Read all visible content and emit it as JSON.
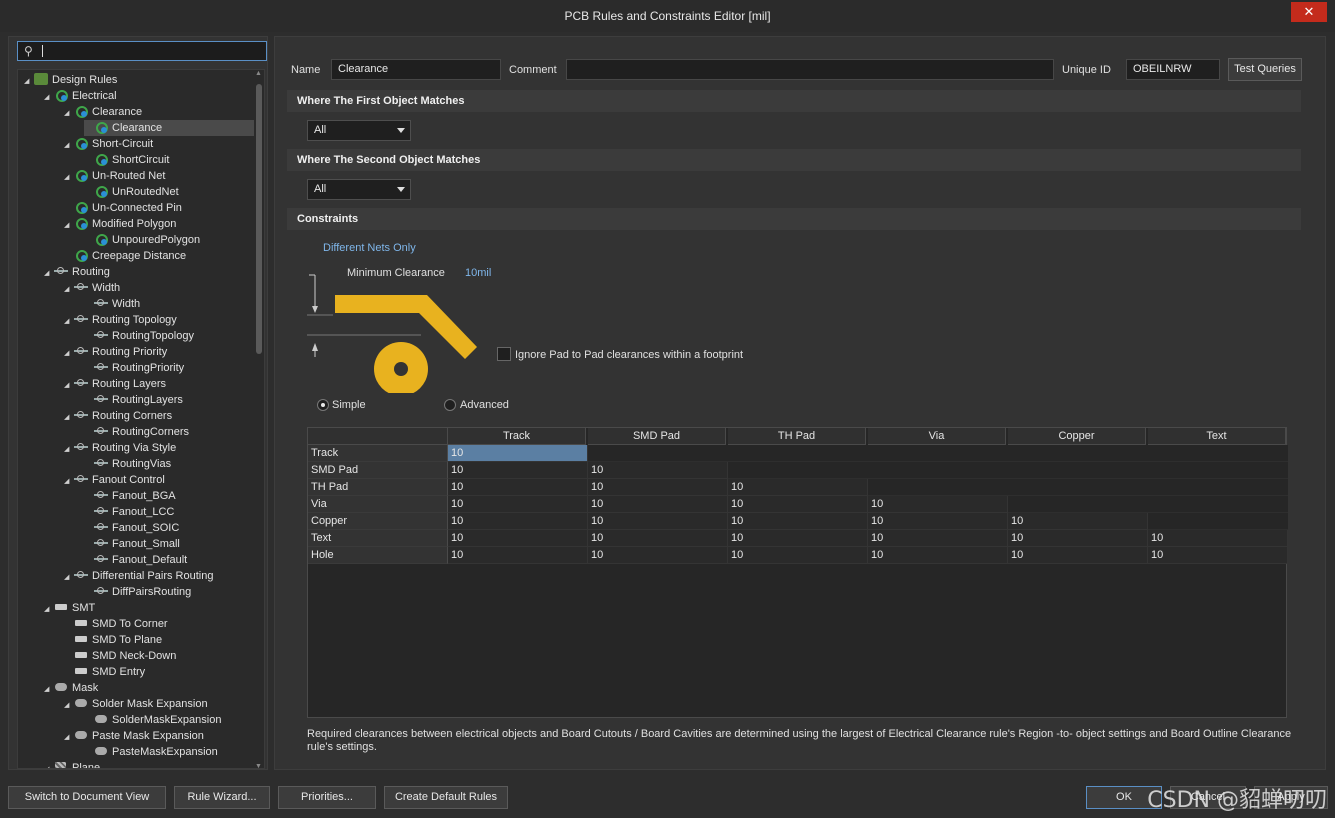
{
  "window": {
    "title": "PCB Rules and Constraints Editor [mil]",
    "close_glyph": "✕"
  },
  "search": {
    "icon": "search-icon",
    "value": ""
  },
  "tree": [
    {
      "label": "Design Rules",
      "icon": "cat",
      "depth": 0,
      "tw": "◢"
    },
    {
      "label": "Electrical",
      "icon": "elec",
      "depth": 1,
      "tw": "◢"
    },
    {
      "label": "Clearance",
      "icon": "elec",
      "depth": 2,
      "tw": "◢"
    },
    {
      "label": "Clearance",
      "icon": "elec",
      "depth": 3,
      "tw": "",
      "selected": true
    },
    {
      "label": "Short-Circuit",
      "icon": "elec",
      "depth": 2,
      "tw": "◢"
    },
    {
      "label": "ShortCircuit",
      "icon": "elec",
      "depth": 3,
      "tw": ""
    },
    {
      "label": "Un-Routed Net",
      "icon": "elec",
      "depth": 2,
      "tw": "◢"
    },
    {
      "label": "UnRoutedNet",
      "icon": "elec",
      "depth": 3,
      "tw": ""
    },
    {
      "label": "Un-Connected Pin",
      "icon": "elec",
      "depth": 2,
      "tw": ""
    },
    {
      "label": "Modified Polygon",
      "icon": "elec",
      "depth": 2,
      "tw": "◢"
    },
    {
      "label": "UnpouredPolygon",
      "icon": "elec",
      "depth": 3,
      "tw": ""
    },
    {
      "label": "Creepage Distance",
      "icon": "elec",
      "depth": 2,
      "tw": ""
    },
    {
      "label": "Routing",
      "icon": "route",
      "depth": 1,
      "tw": "◢"
    },
    {
      "label": "Width",
      "icon": "route",
      "depth": 2,
      "tw": "◢"
    },
    {
      "label": "Width",
      "icon": "route",
      "depth": 3,
      "tw": ""
    },
    {
      "label": "Routing Topology",
      "icon": "route",
      "depth": 2,
      "tw": "◢"
    },
    {
      "label": "RoutingTopology",
      "icon": "route",
      "depth": 3,
      "tw": ""
    },
    {
      "label": "Routing Priority",
      "icon": "route",
      "depth": 2,
      "tw": "◢"
    },
    {
      "label": "RoutingPriority",
      "icon": "route",
      "depth": 3,
      "tw": ""
    },
    {
      "label": "Routing Layers",
      "icon": "route",
      "depth": 2,
      "tw": "◢"
    },
    {
      "label": "RoutingLayers",
      "icon": "route",
      "depth": 3,
      "tw": ""
    },
    {
      "label": "Routing Corners",
      "icon": "route",
      "depth": 2,
      "tw": "◢"
    },
    {
      "label": "RoutingCorners",
      "icon": "route",
      "depth": 3,
      "tw": ""
    },
    {
      "label": "Routing Via Style",
      "icon": "route",
      "depth": 2,
      "tw": "◢"
    },
    {
      "label": "RoutingVias",
      "icon": "route",
      "depth": 3,
      "tw": ""
    },
    {
      "label": "Fanout Control",
      "icon": "route",
      "depth": 2,
      "tw": "◢"
    },
    {
      "label": "Fanout_BGA",
      "icon": "route",
      "depth": 3,
      "tw": ""
    },
    {
      "label": "Fanout_LCC",
      "icon": "route",
      "depth": 3,
      "tw": ""
    },
    {
      "label": "Fanout_SOIC",
      "icon": "route",
      "depth": 3,
      "tw": ""
    },
    {
      "label": "Fanout_Small",
      "icon": "route",
      "depth": 3,
      "tw": ""
    },
    {
      "label": "Fanout_Default",
      "icon": "route",
      "depth": 3,
      "tw": ""
    },
    {
      "label": "Differential Pairs Routing",
      "icon": "route",
      "depth": 2,
      "tw": "◢"
    },
    {
      "label": "DiffPairsRouting",
      "icon": "route",
      "depth": 3,
      "tw": ""
    },
    {
      "label": "SMT",
      "icon": "smt",
      "depth": 1,
      "tw": "◢"
    },
    {
      "label": "SMD To Corner",
      "icon": "smt",
      "depth": 2,
      "tw": ""
    },
    {
      "label": "SMD To Plane",
      "icon": "smt",
      "depth": 2,
      "tw": ""
    },
    {
      "label": "SMD Neck-Down",
      "icon": "smt",
      "depth": 2,
      "tw": ""
    },
    {
      "label": "SMD Entry",
      "icon": "smt",
      "depth": 2,
      "tw": ""
    },
    {
      "label": "Mask",
      "icon": "mask",
      "depth": 1,
      "tw": "◢"
    },
    {
      "label": "Solder Mask Expansion",
      "icon": "mask",
      "depth": 2,
      "tw": "◢"
    },
    {
      "label": "SolderMaskExpansion",
      "icon": "mask",
      "depth": 3,
      "tw": ""
    },
    {
      "label": "Paste Mask Expansion",
      "icon": "mask",
      "depth": 2,
      "tw": "◢"
    },
    {
      "label": "PasteMaskExpansion",
      "icon": "mask",
      "depth": 3,
      "tw": ""
    },
    {
      "label": "Plane",
      "icon": "plane",
      "depth": 1,
      "tw": "◢"
    }
  ],
  "rule": {
    "name_label": "Name",
    "name_value": "Clearance",
    "comment_label": "Comment",
    "comment_value": "",
    "uid_label": "Unique ID",
    "uid_value": "OBEILNRW",
    "test_queries": "Test Queries"
  },
  "first_match": {
    "title": "Where The First Object Matches",
    "value": "All"
  },
  "second_match": {
    "title": "Where The Second Object Matches",
    "value": "All"
  },
  "constraints": {
    "title": "Constraints",
    "net_scope": "Different Nets Only",
    "min_clearance_label": "Minimum Clearance",
    "min_clearance_value": "10mil",
    "ignore_pad_label": "Ignore Pad to Pad clearances within a footprint",
    "mode_simple": "Simple",
    "mode_advanced": "Advanced",
    "mode_selected": "Simple",
    "diagram_color": "#e8b21f"
  },
  "grid": {
    "columns": [
      "Track",
      "SMD Pad",
      "TH Pad",
      "Via",
      "Copper",
      "Text"
    ],
    "rows": [
      {
        "name": "Track",
        "values": [
          "10"
        ]
      },
      {
        "name": "SMD Pad",
        "values": [
          "10",
          "10"
        ]
      },
      {
        "name": "TH Pad",
        "values": [
          "10",
          "10",
          "10"
        ]
      },
      {
        "name": "Via",
        "values": [
          "10",
          "10",
          "10",
          "10"
        ]
      },
      {
        "name": "Copper",
        "values": [
          "10",
          "10",
          "10",
          "10",
          "10"
        ]
      },
      {
        "name": "Text",
        "values": [
          "10",
          "10",
          "10",
          "10",
          "10",
          "10"
        ]
      },
      {
        "name": "Hole",
        "values": [
          "10",
          "10",
          "10",
          "10",
          "10",
          "10"
        ]
      }
    ]
  },
  "note": "Required clearances between electrical objects and Board Cutouts / Board Cavities are determined using the largest of Electrical Clearance rule's Region -to- object settings and Board Outline Clearance rule's settings.",
  "footer": {
    "switch_view": "Switch to Document View",
    "rule_wizard": "Rule Wizard...",
    "priorities": "Priorities...",
    "create_default": "Create Default Rules",
    "ok": "OK",
    "cancel": "Cancel",
    "apply": "Apply"
  },
  "watermark": "CSDN @貂蝉叨叨"
}
